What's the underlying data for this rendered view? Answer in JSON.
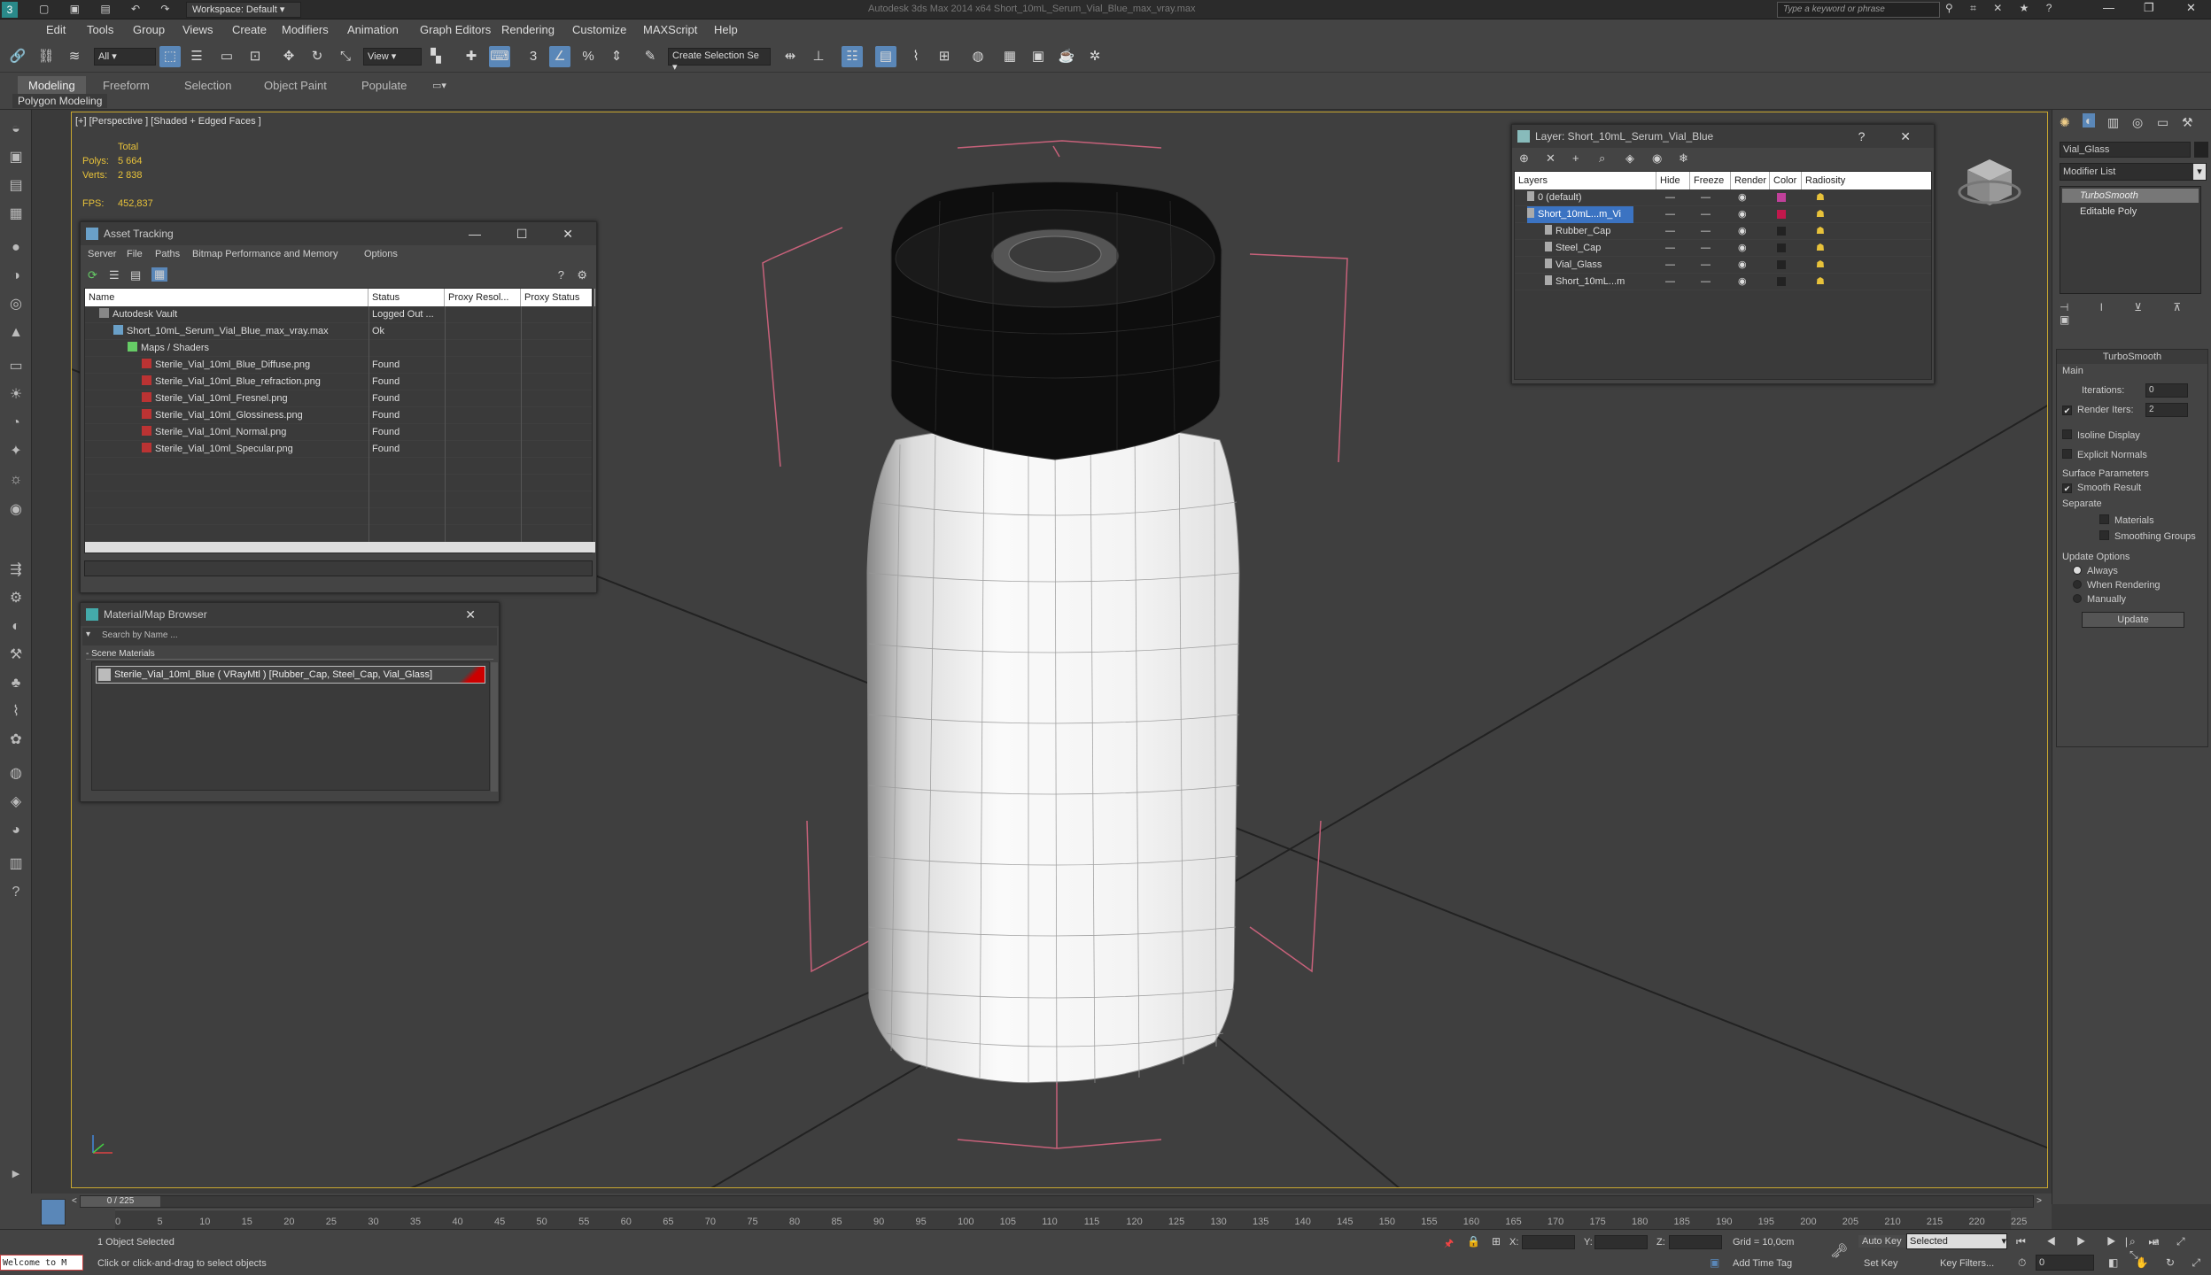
{
  "titlebar": {
    "workspace": "Workspace: Default",
    "title": "Autodesk 3ds Max  2014 x64     Short_10mL_Serum_Vial_Blue_max_vray.max",
    "search_placeholder": "Type a keyword or phrase"
  },
  "menu": [
    "Edit",
    "Tools",
    "Group",
    "Views",
    "Create",
    "Modifiers",
    "Animation",
    "Graph Editors",
    "Rendering",
    "Customize",
    "MAXScript",
    "Help"
  ],
  "toolbar": {
    "filter": "All",
    "view": "View",
    "selection_set": "Create Selection Se"
  },
  "ribbon": {
    "tabs": [
      "Modeling",
      "Freeform",
      "Selection",
      "Object Paint",
      "Populate"
    ],
    "active_tab": "Modeling",
    "sub": "Polygon Modeling"
  },
  "viewport": {
    "label": "[+] [Perspective ] [Shaded + Edged Faces ]",
    "stats_total": "Total",
    "polys_label": "Polys:",
    "polys": "5 664",
    "verts_label": "Verts:",
    "verts": "2 838",
    "fps_label": "FPS:",
    "fps": "452,837"
  },
  "asset_tracking": {
    "title": "Asset Tracking",
    "menu": [
      "Server",
      "File",
      "Paths",
      "Bitmap Performance and Memory",
      "Options"
    ],
    "columns": [
      "Name",
      "Status",
      "Proxy Resol...",
      "Proxy Status"
    ],
    "rows": [
      {
        "name": "Autodesk Vault",
        "status": "Logged Out ...",
        "indent": 1
      },
      {
        "name": "Short_10mL_Serum_Vial_Blue_max_vray.max",
        "status": "Ok",
        "indent": 2
      },
      {
        "name": "Maps / Shaders",
        "status": "",
        "indent": 3
      },
      {
        "name": "Sterile_Vial_10ml_Blue_Diffuse.png",
        "status": "Found",
        "indent": 4
      },
      {
        "name": "Sterile_Vial_10ml_Blue_refraction.png",
        "status": "Found",
        "indent": 4
      },
      {
        "name": "Sterile_Vial_10ml_Fresnel.png",
        "status": "Found",
        "indent": 4
      },
      {
        "name": "Sterile_Vial_10ml_Glossiness.png",
        "status": "Found",
        "indent": 4
      },
      {
        "name": "Sterile_Vial_10ml_Normal.png",
        "status": "Found",
        "indent": 4
      },
      {
        "name": "Sterile_Vial_10ml_Specular.png",
        "status": "Found",
        "indent": 4
      }
    ]
  },
  "material_browser": {
    "title": "Material/Map Browser",
    "search_placeholder": "Search by Name ...",
    "section": "- Scene Materials",
    "material": "Sterile_Vial_10ml_Blue  ( VRayMtl ) [Rubber_Cap, Steel_Cap, Vial_Glass]"
  },
  "layer_panel": {
    "title": "Layer: Short_10mL_Serum_Vial_Blue",
    "columns": [
      "Layers",
      "Hide",
      "Freeze",
      "Render",
      "Color",
      "Radiosity"
    ],
    "rows": [
      {
        "name": "0 (default)",
        "color": "#c0409a",
        "selected": false,
        "indent": 1
      },
      {
        "name": "Short_10mL...m_Vi",
        "color": "#c0184c",
        "selected": true,
        "indent": 1
      },
      {
        "name": "Rubber_Cap",
        "color": "#222222",
        "selected": false,
        "indent": 2
      },
      {
        "name": "Steel_Cap",
        "color": "#222222",
        "selected": false,
        "indent": 2
      },
      {
        "name": "Vial_Glass",
        "color": "#222222",
        "selected": false,
        "indent": 2
      },
      {
        "name": "Short_10mL...m",
        "color": "#222222",
        "selected": false,
        "indent": 2
      }
    ]
  },
  "command_panel": {
    "object_name": "Vial_Glass",
    "modifier_list": "Modifier List",
    "stack": [
      "TurboSmooth",
      "Editable Poly"
    ],
    "rollout": "TurboSmooth",
    "main": "Main",
    "iterations_label": "Iterations:",
    "iterations": "0",
    "render_iters_label": "Render Iters:",
    "render_iters": "2",
    "isoline": "Isoline Display",
    "explicit": "Explicit Normals",
    "surface": "Surface Parameters",
    "smooth_result": "Smooth Result",
    "separate": "Separate",
    "materials": "Materials",
    "smoothing_groups": "Smoothing Groups",
    "update_options": "Update Options",
    "always": "Always",
    "when_rendering": "When Rendering",
    "manually": "Manually",
    "update": "Update"
  },
  "timeline": {
    "frame": "0 / 225",
    "ticks": [
      "0",
      "5",
      "10",
      "15",
      "20",
      "25",
      "30",
      "35",
      "40",
      "45",
      "50",
      "55",
      "60",
      "65",
      "70",
      "75",
      "80",
      "85",
      "90",
      "95",
      "100",
      "105",
      "110",
      "115",
      "120",
      "125",
      "130",
      "135",
      "140",
      "145",
      "150",
      "155",
      "160",
      "165",
      "170",
      "175",
      "180",
      "185",
      "190",
      "195",
      "200",
      "205",
      "210",
      "215",
      "220",
      "225"
    ]
  },
  "status": {
    "listener": "Welcome to M",
    "selected": "1 Object Selected",
    "hint": "Click or click-and-drag to select objects",
    "x_label": "X:",
    "y_label": "Y:",
    "z_label": "Z:",
    "grid": "Grid = 10,0cm",
    "auto_key": "Auto Key",
    "set_key": "Set Key",
    "key_mode": "Selected",
    "key_filters": "Key Filters...",
    "add_time_tag": "Add Time Tag",
    "frame_field": "0"
  }
}
